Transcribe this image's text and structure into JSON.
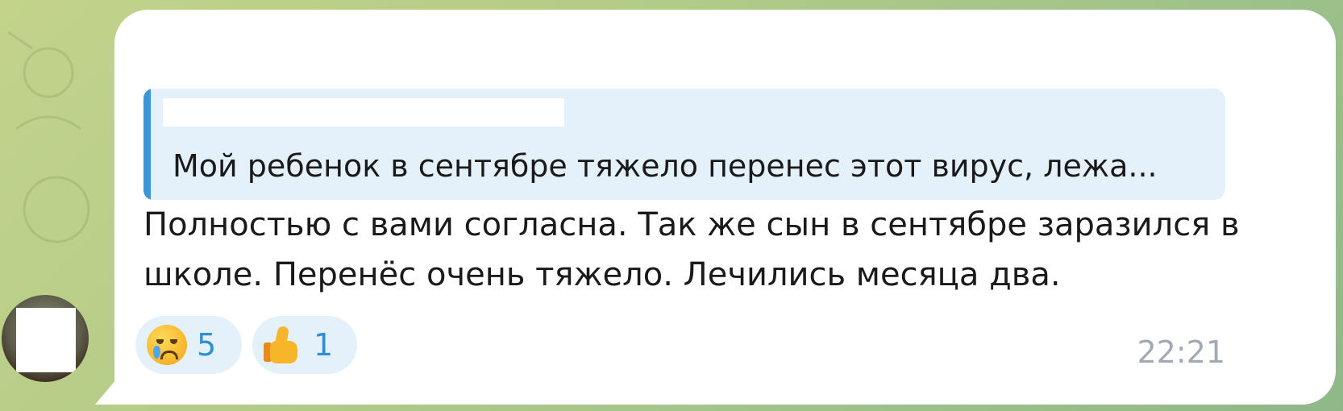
{
  "message": {
    "sender_name": "",
    "reply": {
      "author": "",
      "text": "Мой ребенок в сентябре тяжело перенес этот вирус, лежа..."
    },
    "text": "Полностью с вами согласна. Так же сын в сентябре заразился в школе. Перенёс очень тяжело. Лечились месяца два.",
    "time": "22:21",
    "reactions": [
      {
        "emoji": "crying-face-icon",
        "count": "5"
      },
      {
        "emoji": "thumbs-up-icon",
        "count": "1"
      }
    ]
  },
  "colors": {
    "accent": "#3d95d6",
    "sender_green": "#3aa537",
    "reply_bg": "#e4f1fa",
    "timestamp": "#a1aab3"
  }
}
